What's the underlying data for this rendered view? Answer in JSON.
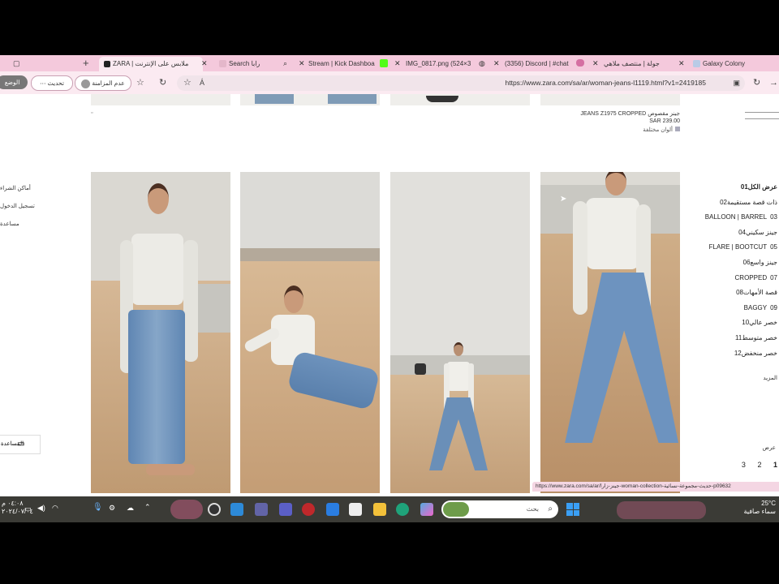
{
  "browser": {
    "tabs": [
      {
        "label": "ZARA | ملابس على الإنترنت",
        "active": true
      },
      {
        "label": "Search رابا"
      },
      {
        "label": "Stream | Kick Dashboa"
      },
      {
        "label": "IMG_0817.png (524×3"
      },
      {
        "label": "(3356) Discord | #chat"
      },
      {
        "label": "جولة | منتصف ملاهي"
      },
      {
        "label": "Galaxy Colony"
      }
    ],
    "new_tab": "+",
    "url": "https://www.zara.com/sa/ar/woman-jeans-l1119.html?v1=2419185",
    "profile_label": "عدم المزامنة",
    "update_label": "تحديث",
    "extra_label": "الوضع"
  },
  "product_top": {
    "name": "JEANS Z1975 CROPPED جينز مقصوص",
    "price": "SAR 239.00",
    "colors": "ألوان مختلفة"
  },
  "right_menu": [
    {
      "num": "01",
      "label": "عرض الكل"
    },
    {
      "num": "02",
      "label": "ذات قصة مستقيمة"
    },
    {
      "num": "03",
      "label": "BALLOON | BARREL"
    },
    {
      "num": "04",
      "label": "جينز سكيني"
    },
    {
      "num": "05",
      "label": "FLARE | BOOTCUT"
    },
    {
      "num": "06",
      "label": "جينز واسع"
    },
    {
      "num": "07",
      "label": "CROPPED"
    },
    {
      "num": "08",
      "label": "قصة الأمهات"
    },
    {
      "num": "09",
      "label": "BAGGY"
    },
    {
      "num": "10",
      "label": "خصر عالي"
    },
    {
      "num": "11",
      "label": "خصر متوسط"
    },
    {
      "num": "12",
      "label": "خصر منخفض"
    }
  ],
  "right_extra": {
    "more": "المزيد",
    "view": "عرض"
  },
  "pagination": [
    "3",
    "2",
    "1"
  ],
  "left_links": [
    "أماكن الشراء",
    "تسجيل الدخول",
    "مساعدة"
  ],
  "left_chat": "المساعدة",
  "status_url": "https://www.zara.com/sa/ar/جينز-زارا-woman-collection-حديث-مجموعة-نسائية-p09632",
  "search_placeholder": "بحث",
  "clock": {
    "time": "٠٤:٠٨ م",
    "date": "٢٠٢٤/٠٧/٠٤"
  },
  "weather": {
    "temp": "25°C",
    "desc": "سماء صافية"
  },
  "colors": {
    "tab_bar": "#f4c9dc",
    "taskbar": "#3b3b36",
    "sand": "#c9a47c",
    "sky": "#dcdad4"
  }
}
